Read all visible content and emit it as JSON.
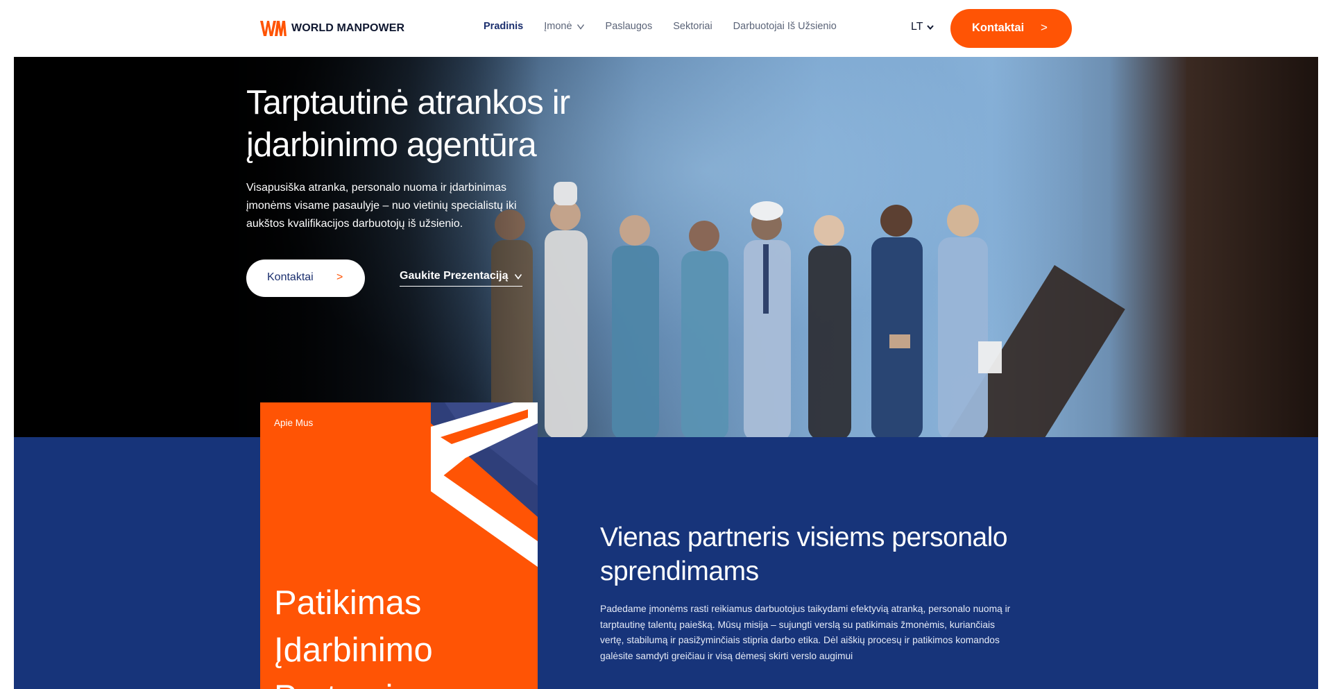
{
  "brand": {
    "name": "WORLD MANPOWER",
    "accent": "#ff5405",
    "navy": "#17347a"
  },
  "nav": {
    "items": [
      {
        "label": "Pradinis",
        "active": true
      },
      {
        "label": "Įmonė",
        "dropdown": true
      },
      {
        "label": "Paslaugos"
      },
      {
        "label": "Sektoriai"
      },
      {
        "label": "Darbuotojai Iš Užsienio"
      }
    ],
    "language": "LT",
    "cta_label": "Kontaktai",
    "cta_arrow": ">"
  },
  "hero": {
    "title": "Tarptautinė atrankos ir įdarbinimo agentūra",
    "subtitle": "Visapusiška atranka, personalo nuoma ir įdarbinimas įmonėms visame pasaulyje – nuo vietinių specialistų iki aukštos kvalifikacijos darbuotojų iš užsienio.",
    "primary_button": "Kontaktai",
    "primary_arrow": ">",
    "secondary_link": "Gaukite Prezentaciją"
  },
  "about": {
    "tag": "Apie Mus",
    "card_title": "Patikimas Įdarbinimo Partneris",
    "title": "Vienas partneris visiems personalo sprendimams",
    "text": "Padedame įmonėms rasti reikiamus darbuotojus taikydami efektyvią atranką, personalo nuomą ir tarptautinę talentų paiešką. Mūsų misija – sujungti verslą su patikimais žmonėmis, kuriančiais vertę, stabilumą ir pasižyminčiais stipria darbo etika. Dėl aiškių procesų ir patikimos komandos galėsite samdyti greičiau ir visą dėmesį skirti verslo augimui"
  }
}
